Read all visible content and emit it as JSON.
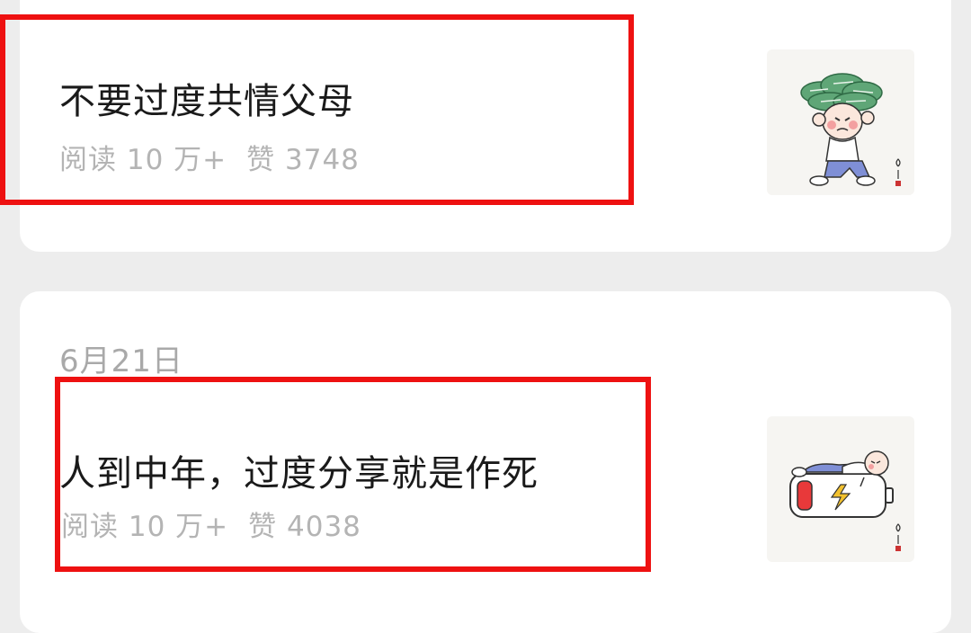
{
  "articles": [
    {
      "date": "",
      "title": "不要过度共情父母",
      "reads": "阅读 10 万+",
      "likes": "赞 3748",
      "thumbnail_icon": "money-head-cartoon-icon"
    },
    {
      "date": "6月21日",
      "title": "人到中年，过度分享就是作死",
      "reads": "阅读 10 万+",
      "likes": "赞 4038",
      "thumbnail_icon": "battery-cartoon-icon"
    }
  ],
  "colors": {
    "background": "#ededed",
    "card": "#ffffff",
    "title": "#1a1a1a",
    "meta": "#b4b4b4",
    "highlight": "#ee1111"
  }
}
